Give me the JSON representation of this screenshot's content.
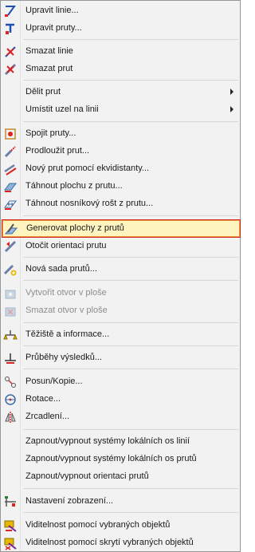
{
  "menu": {
    "items": [
      {
        "label": "Upravit linie...",
        "icon": "edit-lines-icon",
        "enabled": true
      },
      {
        "label": "Upravit pruty...",
        "icon": "edit-members-icon",
        "enabled": true
      },
      {
        "label": "Smazat linie",
        "icon": "delete-line-icon",
        "enabled": true
      },
      {
        "label": "Smazat prut",
        "icon": "delete-member-icon",
        "enabled": true
      },
      {
        "label": "Dělit prut",
        "icon": "",
        "enabled": true,
        "submenu": true
      },
      {
        "label": "Umístit uzel na linii",
        "icon": "",
        "enabled": true,
        "submenu": true
      },
      {
        "label": "Spojit pruty...",
        "icon": "join-members-icon",
        "enabled": true
      },
      {
        "label": "Prodloužit prut...",
        "icon": "extend-member-icon",
        "enabled": true
      },
      {
        "label": "Nový prut pomocí ekvidistanty...",
        "icon": "offset-member-icon",
        "enabled": true
      },
      {
        "label": "Táhnout plochu z prutu...",
        "icon": "extrude-surface-icon",
        "enabled": true
      },
      {
        "label": "Táhnout nosníkový rošt z prutu...",
        "icon": "extrude-grillage-icon",
        "enabled": true
      },
      {
        "label": "Generovat plochy z prutů",
        "icon": "generate-surfaces-icon",
        "enabled": true,
        "highlighted": true
      },
      {
        "label": "Otočit orientaci prutu",
        "icon": "rotate-orientation-icon",
        "enabled": true
      },
      {
        "label": "Nová sada prutů...",
        "icon": "new-member-set-icon",
        "enabled": true
      },
      {
        "label": "Vytvořit otvor v ploše",
        "icon": "create-opening-icon",
        "enabled": false
      },
      {
        "label": "Smazat otvor v ploše",
        "icon": "delete-opening-icon",
        "enabled": false
      },
      {
        "label": "Těžiště a informace...",
        "icon": "centroid-info-icon",
        "enabled": true
      },
      {
        "label": "Průběhy výsledků...",
        "icon": "result-diagrams-icon",
        "enabled": true
      },
      {
        "label": "Posun/Kopie...",
        "icon": "move-copy-icon",
        "enabled": true
      },
      {
        "label": "Rotace...",
        "icon": "rotate-icon",
        "enabled": true
      },
      {
        "label": "Zrcadlení...",
        "icon": "mirror-icon",
        "enabled": true
      },
      {
        "label": "Zapnout/vypnout systémy lokálních os linií",
        "icon": "",
        "enabled": true
      },
      {
        "label": "Zapnout/vypnout systémy lokálních os prutů",
        "icon": "",
        "enabled": true
      },
      {
        "label": "Zapnout/vypnout orientaci prutů",
        "icon": "",
        "enabled": true
      },
      {
        "label": "Nastavení zobrazení...",
        "icon": "display-settings-icon",
        "enabled": true
      },
      {
        "label": "Viditelnost pomocí vybraných objektů",
        "icon": "visibility-selected-icon",
        "enabled": true
      },
      {
        "label": "Viditelnost pomocí skrytí vybraných objektů",
        "icon": "visibility-hide-selected-icon",
        "enabled": true
      }
    ]
  },
  "colors": {
    "highlight_bg": "#fdf4bf",
    "highlight_border": "#e8a33a",
    "highlight_outline": "#d21f1f",
    "disabled_text": "#8d8d8d"
  }
}
